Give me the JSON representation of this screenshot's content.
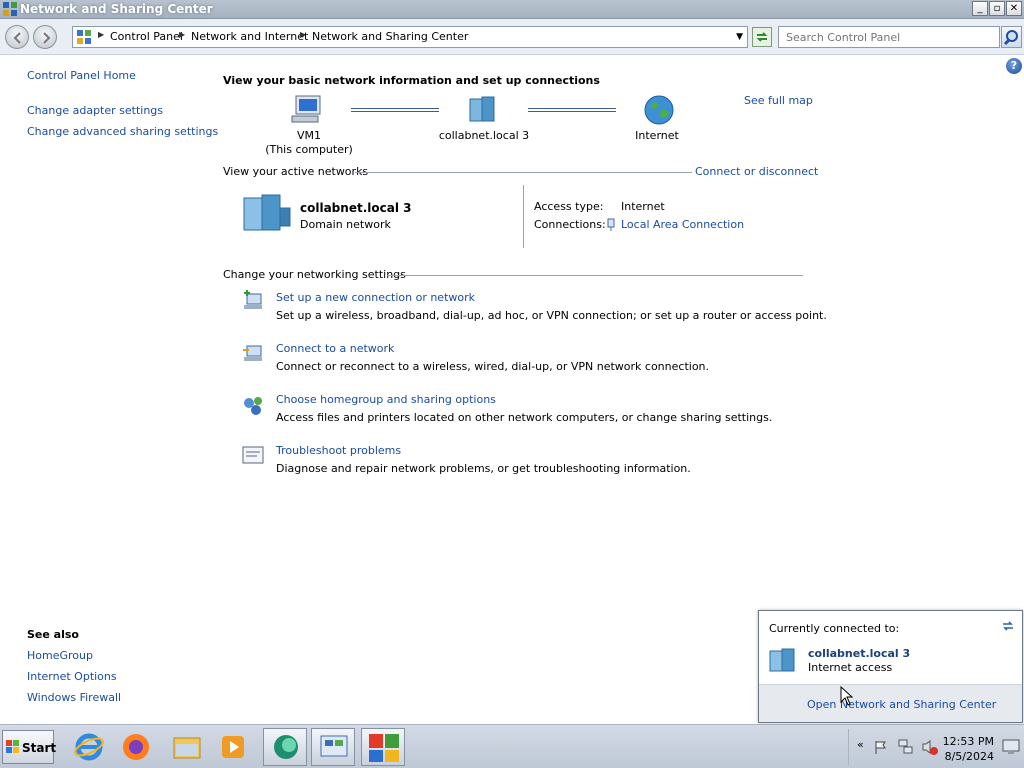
{
  "window": {
    "title": "Network and Sharing Center",
    "buttons": {
      "minimize": "_",
      "maximize": "▫",
      "close": "✕"
    }
  },
  "address": {
    "crumbs": [
      "Control Panel",
      "Network and Internet",
      "Network and Sharing Center"
    ],
    "search_placeholder": "Search Control Panel"
  },
  "sidebar": {
    "home": "Control Panel Home",
    "links": [
      "Change adapter settings",
      "Change advanced sharing settings"
    ],
    "see_also_title": "See also",
    "see_also": [
      "HomeGroup",
      "Internet Options",
      "Windows Firewall"
    ]
  },
  "main": {
    "title": "View your basic network information and set up connections",
    "see_full_map": "See full map",
    "map": {
      "computer": "VM1",
      "computer_sub": "(This computer)",
      "network": "collabnet.local  3",
      "internet": "Internet"
    },
    "active_header": "View your active networks",
    "connect_disconnect": "Connect or disconnect",
    "active_network": {
      "name": "collabnet.local  3",
      "type": "Domain network",
      "access_label": "Access type:",
      "access_value": "Internet",
      "connections_label": "Connections:",
      "connection_value": "Local Area Connection"
    },
    "settings_header": "Change your networking settings",
    "tasks": [
      {
        "link": "Set up a new connection or network",
        "desc": "Set up a wireless, broadband, dial-up, ad hoc, or VPN connection; or set up a router or access point."
      },
      {
        "link": "Connect to a network",
        "desc": "Connect or reconnect to a wireless, wired, dial-up, or VPN network connection."
      },
      {
        "link": "Choose homegroup and sharing options",
        "desc": "Access files and printers located on other network computers, or change sharing settings."
      },
      {
        "link": "Troubleshoot problems",
        "desc": "Diagnose and repair network problems, or get troubleshooting information."
      }
    ]
  },
  "flyout": {
    "title": "Currently connected to:",
    "network": "collabnet.local  3",
    "status": "Internet access",
    "open_link": "Open Network and Sharing Center"
  },
  "taskbar": {
    "start": "Start",
    "time": "12:53 PM",
    "date": "8/5/2024"
  },
  "colors": {
    "link": "#1a4ca3",
    "titlebar": "#a7b2c0",
    "taskbar": "#c6cfdc"
  }
}
